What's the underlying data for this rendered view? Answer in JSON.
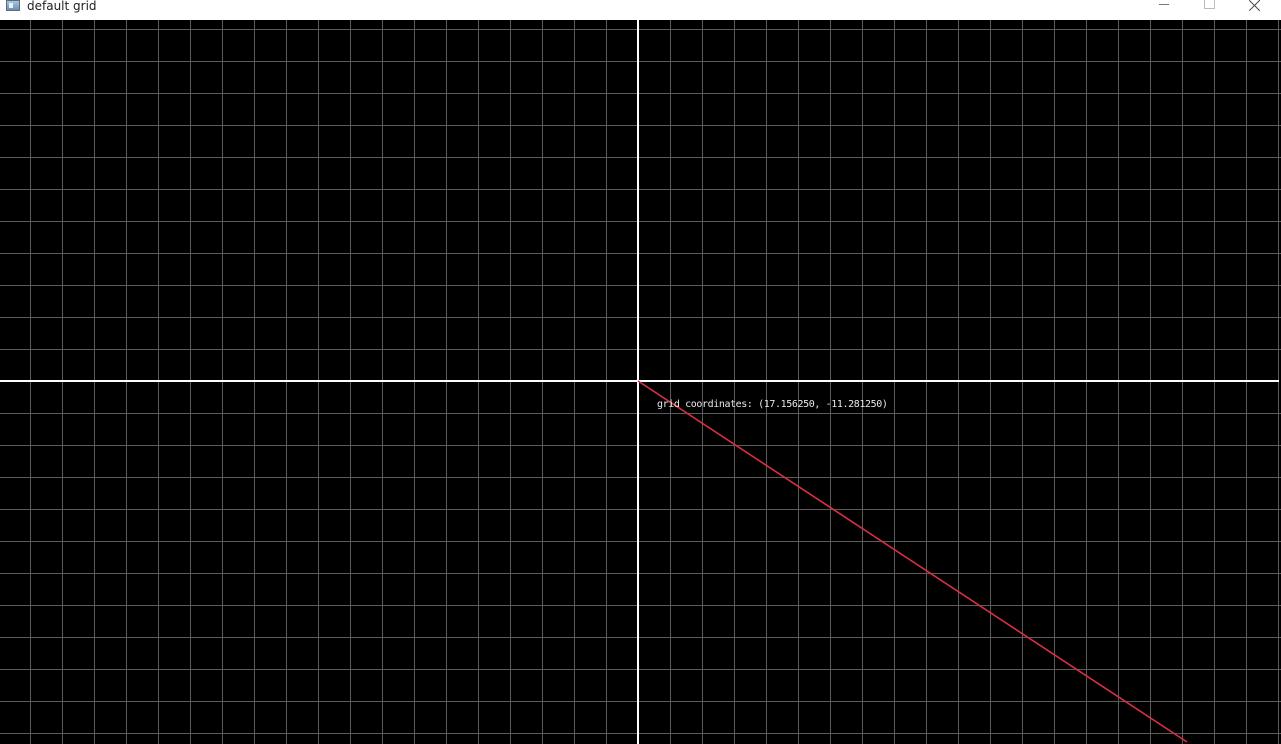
{
  "window": {
    "title": "default grid",
    "buttons": {
      "minimize": "minimize",
      "maximize": "maximize",
      "close": "close"
    }
  },
  "grid": {
    "background_color": "#000000",
    "grid_line_color": "#5a5a5a",
    "axis_color": "#ffffff",
    "line_color": "#dc2f42",
    "line_x_range": [
      0,
      17.15625
    ],
    "line_y_range": [
      0,
      -11.28125
    ],
    "visible_x_range": [
      -20,
      20
    ],
    "visible_y_range": [
      -11.28125,
      11.28125
    ]
  },
  "readout": {
    "label": "grid coordinates: (17.156250, -11.281250)"
  }
}
